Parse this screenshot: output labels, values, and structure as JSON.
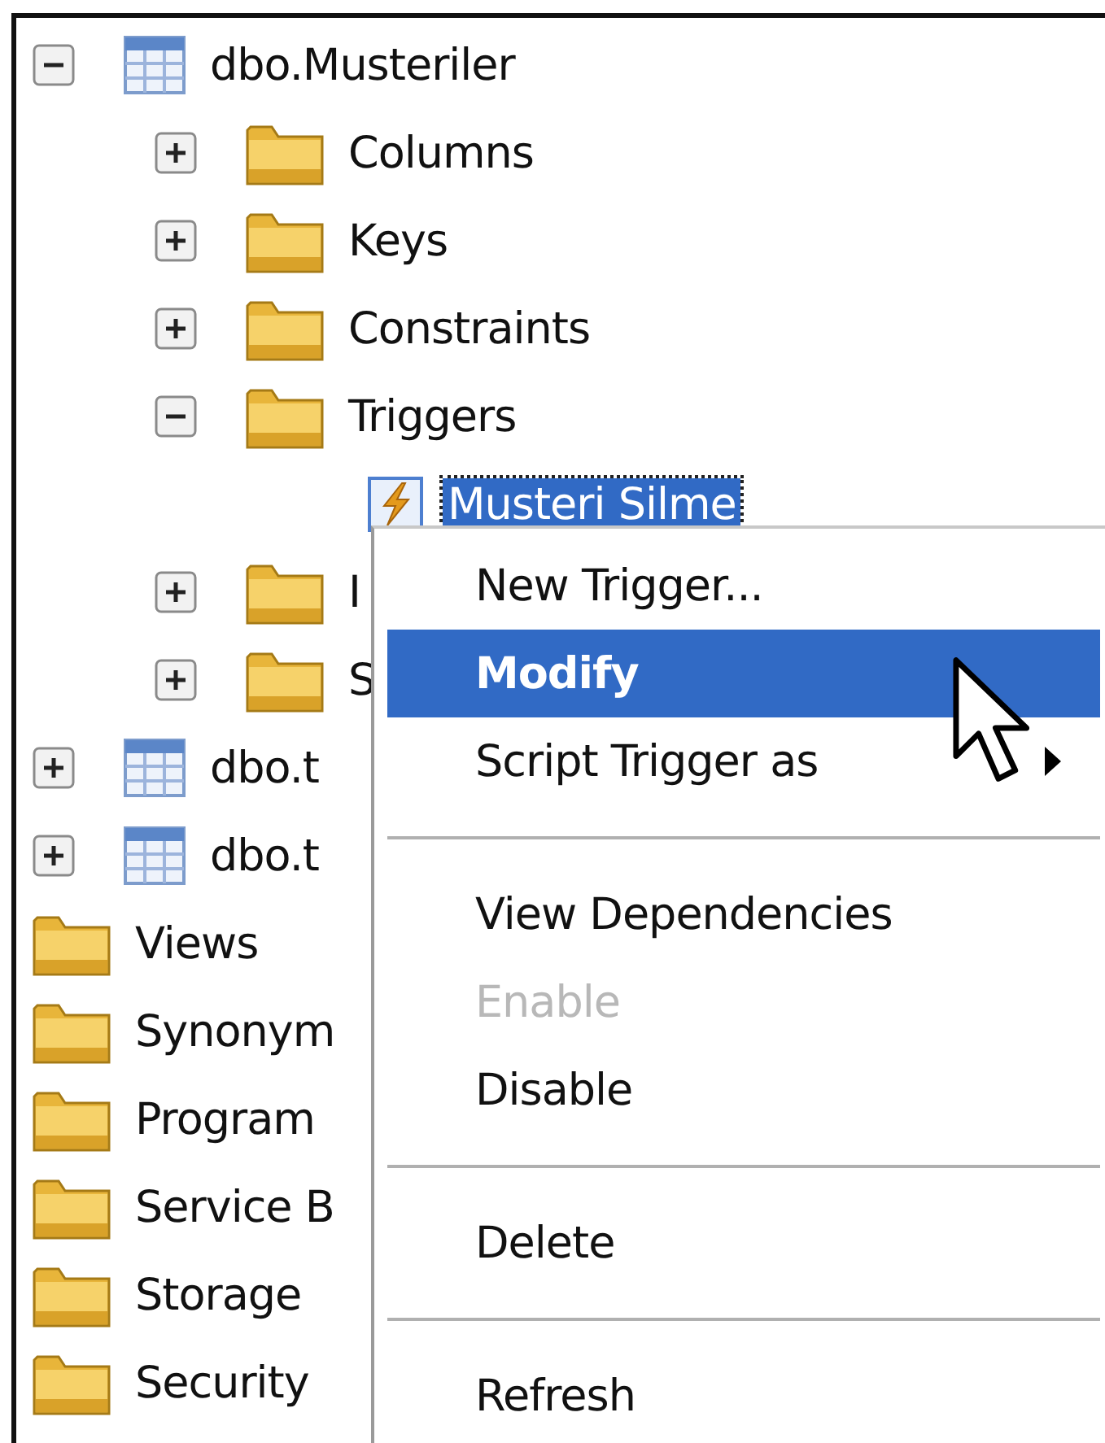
{
  "tree": [
    {
      "kind": "table",
      "label": "dbo.Musteriler",
      "expanded": true,
      "selected": false,
      "children": [
        {
          "kind": "folder",
          "label": "Columns",
          "expanded": false,
          "selected": false
        },
        {
          "kind": "folder",
          "label": "Keys",
          "expanded": false,
          "selected": false
        },
        {
          "kind": "folder",
          "label": "Constraints",
          "expanded": false,
          "selected": false
        },
        {
          "kind": "folder",
          "label": "Triggers",
          "expanded": true,
          "selected": false,
          "children": [
            {
              "kind": "trigger",
              "label": "Musteri Silme",
              "selected": true
            }
          ]
        },
        {
          "kind": "folder",
          "label": "I",
          "expanded": false,
          "selected": false
        },
        {
          "kind": "folder",
          "label": "S",
          "expanded": false,
          "selected": false
        }
      ]
    },
    {
      "kind": "table",
      "label": "dbo.t",
      "expanded": false,
      "selected": false
    },
    {
      "kind": "table",
      "label": "dbo.t",
      "expanded": false,
      "selected": false
    },
    {
      "kind": "folder",
      "label": "Views",
      "selected": false
    },
    {
      "kind": "folder",
      "label": "Synonym",
      "selected": false
    },
    {
      "kind": "folder",
      "label": "Program",
      "selected": false
    },
    {
      "kind": "folder",
      "label": "Service B",
      "selected": false
    },
    {
      "kind": "folder",
      "label": "Storage",
      "selected": false
    },
    {
      "kind": "folder",
      "label": "Security",
      "selected": false
    }
  ],
  "context_menu": [
    {
      "kind": "item",
      "label": "New Trigger...",
      "selected": false,
      "disabled": false
    },
    {
      "kind": "item",
      "label": "Modify",
      "selected": true,
      "disabled": false
    },
    {
      "kind": "item",
      "label": "Script Trigger as",
      "selected": false,
      "disabled": false,
      "submenu": true
    },
    {
      "kind": "separator"
    },
    {
      "kind": "item",
      "label": "View Dependencies",
      "selected": false,
      "disabled": false
    },
    {
      "kind": "item",
      "label": "Enable",
      "selected": false,
      "disabled": true
    },
    {
      "kind": "item",
      "label": "Disable",
      "selected": false,
      "disabled": false
    },
    {
      "kind": "separator"
    },
    {
      "kind": "item",
      "label": "Delete",
      "selected": false,
      "disabled": false
    },
    {
      "kind": "separator"
    },
    {
      "kind": "item",
      "label": "Refresh",
      "selected": false,
      "disabled": false
    }
  ]
}
